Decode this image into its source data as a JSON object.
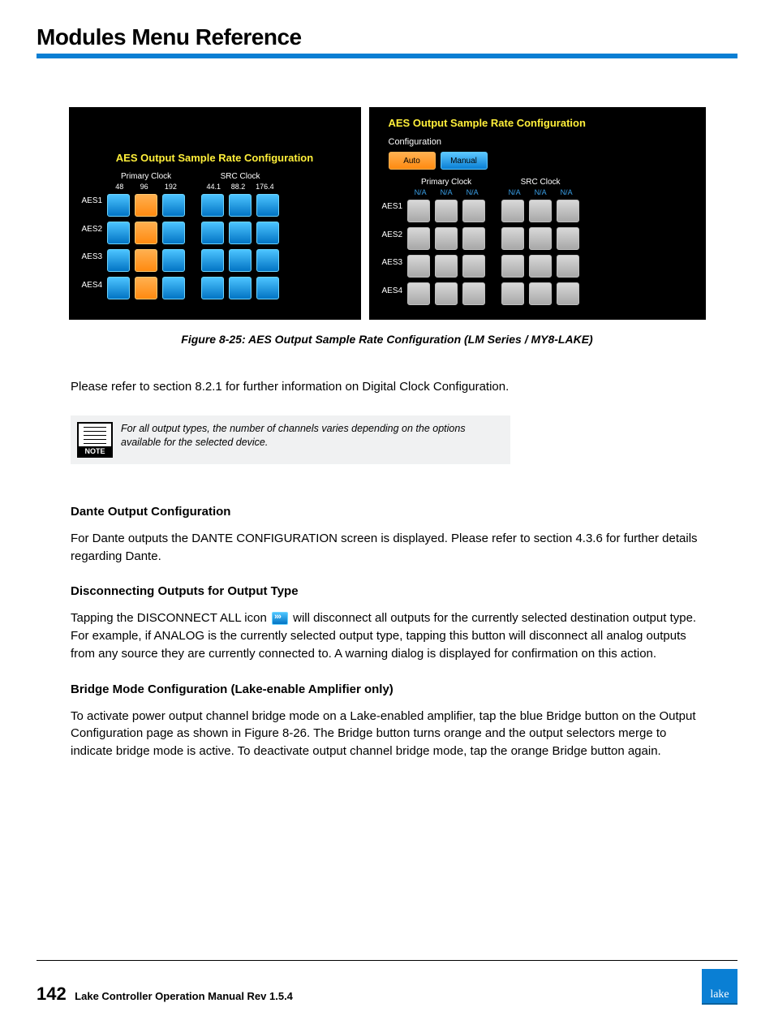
{
  "header": {
    "title": "Modules Menu Reference"
  },
  "panels": {
    "left": {
      "title": "AES Output Sample Rate Configuration",
      "rowLabels": [
        "AES1",
        "AES2",
        "AES3",
        "AES4"
      ],
      "primary": {
        "label": "Primary Clock",
        "cols": [
          "48",
          "96",
          "192"
        ],
        "cells": [
          "blue",
          "orange",
          "blue",
          "blue",
          "orange",
          "blue",
          "blue",
          "orange",
          "blue",
          "blue",
          "orange",
          "blue"
        ]
      },
      "src": {
        "label": "SRC Clock",
        "cols": [
          "44.1",
          "88.2",
          "176.4"
        ],
        "cells": [
          "blue",
          "blue",
          "blue",
          "blue",
          "blue",
          "blue",
          "blue",
          "blue",
          "blue",
          "blue",
          "blue",
          "blue"
        ]
      }
    },
    "right": {
      "title": "AES Output Sample Rate Configuration",
      "configLabel": "Configuration",
      "autoLabel": "Auto",
      "manualLabel": "Manual",
      "rowLabels": [
        "AES1",
        "AES2",
        "AES3",
        "AES4"
      ],
      "primary": {
        "label": "Primary Clock",
        "cols": [
          "N/A",
          "N/A",
          "N/A"
        ],
        "cells": [
          "gray",
          "gray",
          "gray",
          "gray",
          "gray",
          "gray",
          "gray",
          "gray",
          "gray",
          "gray",
          "gray",
          "gray"
        ]
      },
      "src": {
        "label": "SRC Clock",
        "cols": [
          "N/A",
          "N/A",
          "N/A"
        ],
        "cells": [
          "gray",
          "gray",
          "gray",
          "gray",
          "gray",
          "gray",
          "gray",
          "gray",
          "gray",
          "gray",
          "gray",
          "gray"
        ]
      }
    }
  },
  "caption": "Figure 8-25: AES Output Sample Rate Configuration (LM Series / MY8-LAKE)",
  "para1": "Please refer to section 8.2.1 for further information on Digital Clock Configuration.",
  "note": {
    "label": "NOTE",
    "text": "For all output types, the number of channels varies depending on the options available for the selected device."
  },
  "sections": {
    "dante": {
      "heading": "Dante Output Configuration",
      "body": "For Dante outputs the DANTE CONFIGURATION screen is displayed. Please refer to section 4.3.6 for further details regarding Dante."
    },
    "disconnect": {
      "heading": "Disconnecting Outputs for Output Type",
      "bodyA": "Tapping the DISCONNECT ALL icon ",
      "bodyB": " will disconnect all outputs for the currently selected destination output type. For example, if ANALOG is the currently selected output type, tapping this button will disconnect all analog outputs from any source they are currently connected to. A warning dialog is displayed for confirmation on this action."
    },
    "bridge": {
      "heading": "Bridge Mode Configuration (Lake-enable Amplifier only)",
      "body": "To activate power output channel bridge mode on a Lake-enabled amplifier, tap the blue Bridge button on the Output Configuration page as shown in Figure 8-26. The Bridge button turns orange and the output selectors merge to indicate bridge mode is active. To deactivate output channel  bridge mode, tap the orange Bridge button again."
    }
  },
  "footer": {
    "page": "142",
    "text": "Lake Controller Operation Manual Rev 1.5.4",
    "logo": "lake"
  }
}
